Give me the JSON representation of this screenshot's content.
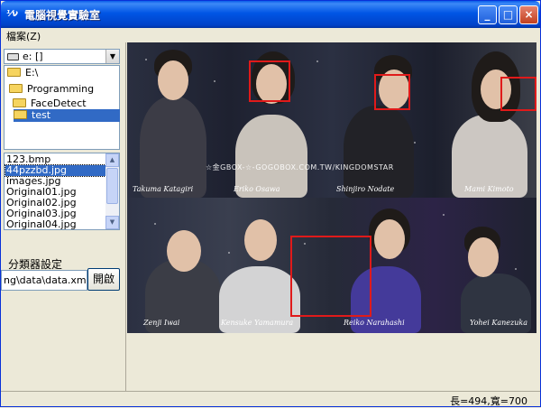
{
  "window": {
    "title": "電腦視覺實驗室",
    "icon": "app-icon",
    "min_label": "_",
    "max_label": "□",
    "close_label": "×"
  },
  "menu": {
    "file": "檔案(Z)"
  },
  "drive": {
    "value": "e: []"
  },
  "directories": [
    {
      "label": "E:\\"
    },
    {
      "label": "Programming"
    },
    {
      "label": "FaceDetect"
    },
    {
      "label": "test",
      "selected": true
    }
  ],
  "files": [
    "123.bmp",
    "44pzzbd.jpg",
    "images.jpg",
    "Original01.jpg",
    "Original02.jpg",
    "Original03.jpg",
    "Original04.jpg"
  ],
  "selected_file": "44pzzbd.jpg",
  "classifier": {
    "label": "分類器設定",
    "path": "ng\\data\\data.xml",
    "open_button": "開啟"
  },
  "photo": {
    "watermark": "☆金GBOX-☆-GOGOBOX.COM.TW/KINGDOMSTAR",
    "names_top": [
      "Takuma Katagiri",
      "Eriko Osawa",
      "Shinjiro Nodate",
      "Mami Kimoto"
    ],
    "names_bottom": [
      "Zenji Iwai",
      "Kensuke Yamamura",
      "Reiko Narahashi",
      "Yohei Kanezuka"
    ]
  },
  "status": {
    "text": "長=494,寬=700"
  }
}
